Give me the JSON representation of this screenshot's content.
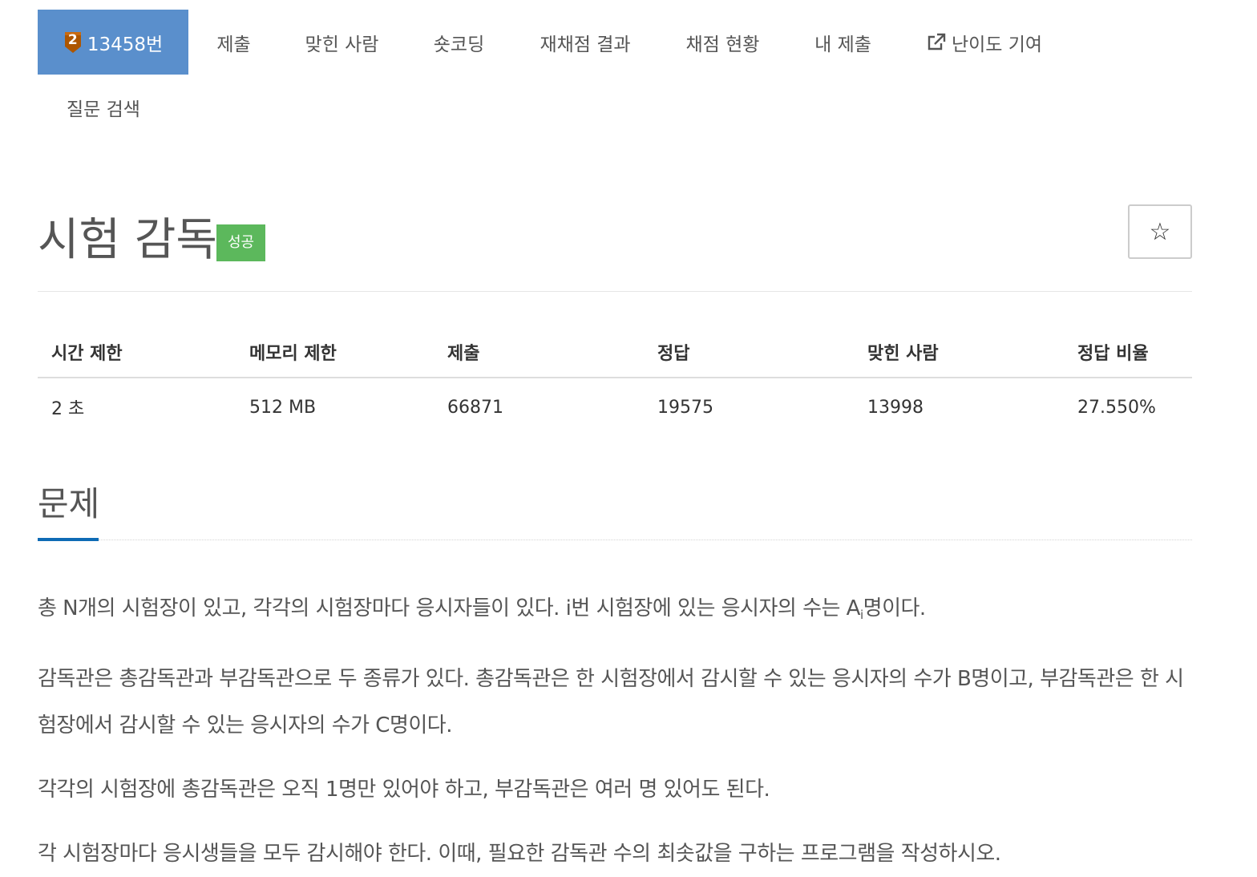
{
  "nav": {
    "problem_tier": "2",
    "problem_number": "13458번",
    "tabs": [
      "제출",
      "맞힌 사람",
      "숏코딩",
      "재채점 결과",
      "채점 현황",
      "내 제출",
      "난이도 기여",
      "질문 검색"
    ]
  },
  "problem": {
    "title": "시험 감독",
    "status_badge": "성공",
    "star": "☆"
  },
  "info_table": {
    "headers": [
      "시간 제한",
      "메모리 제한",
      "제출",
      "정답",
      "맞힌 사람",
      "정답 비율"
    ],
    "values": [
      "2 초",
      "512 MB",
      "66871",
      "19575",
      "13998",
      "27.550%"
    ]
  },
  "section": {
    "title": "문제",
    "p1_a": "총 N개의 시험장이 있고, 각각의 시험장마다 응시자들이 있다. i번 시험장에 있는 응시자의 수는 A",
    "p1_sub": "i",
    "p1_b": "명이다.",
    "p2": "감독관은 총감독관과 부감독관으로 두 종류가 있다. 총감독관은 한 시험장에서 감시할 수 있는 응시자의 수가 B명이고, 부감독관은 한 시험장에서 감시할 수 있는 응시자의 수가 C명이다.",
    "p3": "각각의 시험장에 총감독관은 오직 1명만 있어야 하고, 부감독관은 여러 명 있어도 된다.",
    "p4": "각 시험장마다 응시생들을 모두 감시해야 한다. 이때, 필요한 감독관 수의 최솟값을 구하는 프로그램을 작성하시오."
  },
  "colors": {
    "active_tab": "#5a8fcc",
    "tier_bronze": "#ad5600",
    "success_badge": "#5cb85c",
    "section_underline": "#0e6bb5"
  },
  "icons": [
    "bronze-tier-icon",
    "external-link-icon",
    "star-icon"
  ]
}
